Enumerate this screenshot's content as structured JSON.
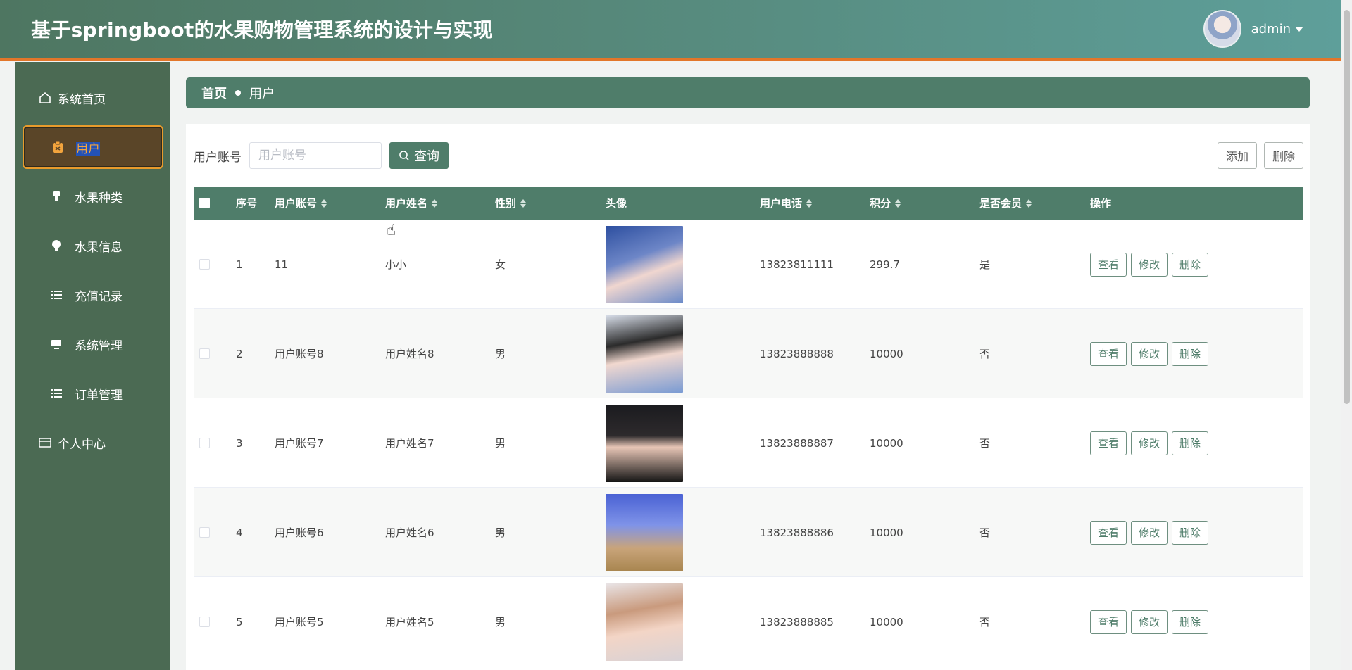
{
  "header": {
    "title": "基于springboot的水果购物管理系统的设计与实现",
    "username": "admin"
  },
  "sidebar": {
    "items": [
      {
        "label": "系统首页",
        "icon": "home-icon"
      },
      {
        "label": "用户",
        "icon": "clipboard-icon"
      },
      {
        "label": "水果种类",
        "icon": "brush-icon"
      },
      {
        "label": "水果信息",
        "icon": "bulb-icon"
      },
      {
        "label": "充值记录",
        "icon": "list-icon"
      },
      {
        "label": "系统管理",
        "icon": "monitor-icon"
      },
      {
        "label": "订单管理",
        "icon": "list-icon"
      },
      {
        "label": "个人中心",
        "icon": "card-icon"
      }
    ]
  },
  "breadcrumb": {
    "home": "首页",
    "current": "用户"
  },
  "search": {
    "label": "用户账号",
    "placeholder": "用户账号",
    "button": "查询"
  },
  "actions": {
    "add": "添加",
    "delete": "删除"
  },
  "table": {
    "headers": [
      "序号",
      "用户账号",
      "用户姓名",
      "性别",
      "头像",
      "用户电话",
      "积分",
      "是否会员",
      "操作"
    ],
    "row_buttons": {
      "view": "查看",
      "edit": "修改",
      "delete": "删除"
    },
    "rows": [
      {
        "no": "1",
        "account": "11",
        "name": "小小",
        "gender": "女",
        "phone": "13823811111",
        "points": "299.7",
        "member": "是"
      },
      {
        "no": "2",
        "account": "用户账号8",
        "name": "用户姓名8",
        "gender": "男",
        "phone": "13823888888",
        "points": "10000",
        "member": "否"
      },
      {
        "no": "3",
        "account": "用户账号7",
        "name": "用户姓名7",
        "gender": "男",
        "phone": "13823888887",
        "points": "10000",
        "member": "否"
      },
      {
        "no": "4",
        "account": "用户账号6",
        "name": "用户姓名6",
        "gender": "男",
        "phone": "13823888886",
        "points": "10000",
        "member": "否"
      },
      {
        "no": "5",
        "account": "用户账号5",
        "name": "用户姓名5",
        "gender": "男",
        "phone": "13823888885",
        "points": "10000",
        "member": "否"
      }
    ]
  },
  "colors": {
    "primary": "#4f7d6a",
    "sidebar": "#4b6a53",
    "accent": "#e89b2c"
  }
}
